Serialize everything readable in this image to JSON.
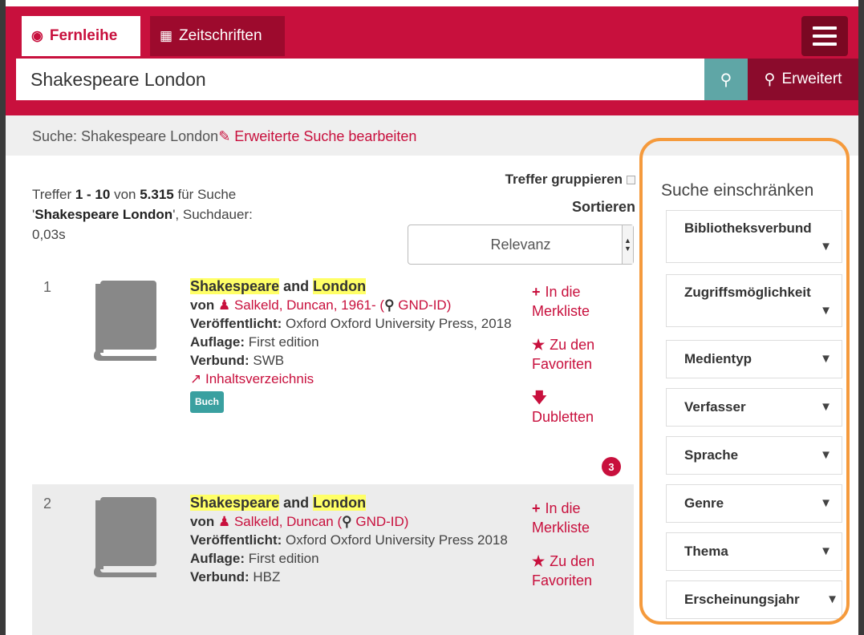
{
  "header": {
    "tabs": [
      {
        "label": "Fernleihe",
        "icon": "globe-icon",
        "active": true
      },
      {
        "label": "Zeitschriften",
        "icon": "newspaper-icon",
        "active": false
      }
    ],
    "menu_icon": "hamburger-icon",
    "search_value": "Shakespeare London",
    "search_icon": "search-icon",
    "advanced_label": "Erweitert",
    "advanced_icon": "zoom-icon",
    "brand_color": "#c8103d"
  },
  "searchline": {
    "prefix": "Suche: Shakespeare London",
    "edit_label": "Erweiterte Suche bearbeiten",
    "edit_icon": "edit-icon"
  },
  "hits": {
    "p1": "Treffer ",
    "range": "1 - 10",
    "p2": " von ",
    "total": "5.315",
    "p3": " für Suche",
    "quote_open": "'",
    "query": "Shakespeare London",
    "p4": "', Suchdauer:",
    "duration": "0,03s"
  },
  "controls": {
    "group_label": "Treffer gruppieren",
    "sort_label": "Sortieren",
    "sort_value": "Relevanz"
  },
  "results": [
    {
      "number": "1",
      "title_a": "Shakespeare",
      "title_and": " and ",
      "title_b": "London",
      "author_prefix": "von ",
      "author": "Salkeld, Duncan, 1961-",
      "gnd_label": "GND-ID",
      "published_label": "Veröffentlicht:",
      "published_value": " Oxford Oxford University Press, 2018",
      "edition_label": "Auflage:",
      "edition_value": " First edition",
      "verbund_label": "Verbund:",
      "verbund_value": " SWB",
      "toc_label": "Inhaltsverzeichnis",
      "badge": "Buch",
      "action_merk": "In die Merkliste",
      "action_fav": "Zu den Favoriten",
      "action_dub": "Dubletten",
      "dub_count": "3"
    },
    {
      "number": "2",
      "title_a": "Shakespeare",
      "title_and": " and ",
      "title_b": "London",
      "author_prefix": "von ",
      "author": "Salkeld, Duncan",
      "gnd_label": "GND-ID",
      "published_label": "Veröffentlicht:",
      "published_value": " Oxford Oxford University Press 2018",
      "edition_label": "Auflage:",
      "edition_value": " First edition",
      "verbund_label": "Verbund:",
      "verbund_value": " HBZ",
      "action_merk": "In die Merkliste",
      "action_fav": "Zu den Favoriten"
    }
  ],
  "sidebar": {
    "title": "Suche einschränken",
    "facets": [
      "Bibliotheksverbund",
      "Zugriffsmöglichkeit",
      "Medientyp",
      "Verfasser",
      "Sprache",
      "Genre",
      "Thema",
      "Erscheinungsjahr"
    ],
    "highlight_color": "#f59a3c"
  }
}
